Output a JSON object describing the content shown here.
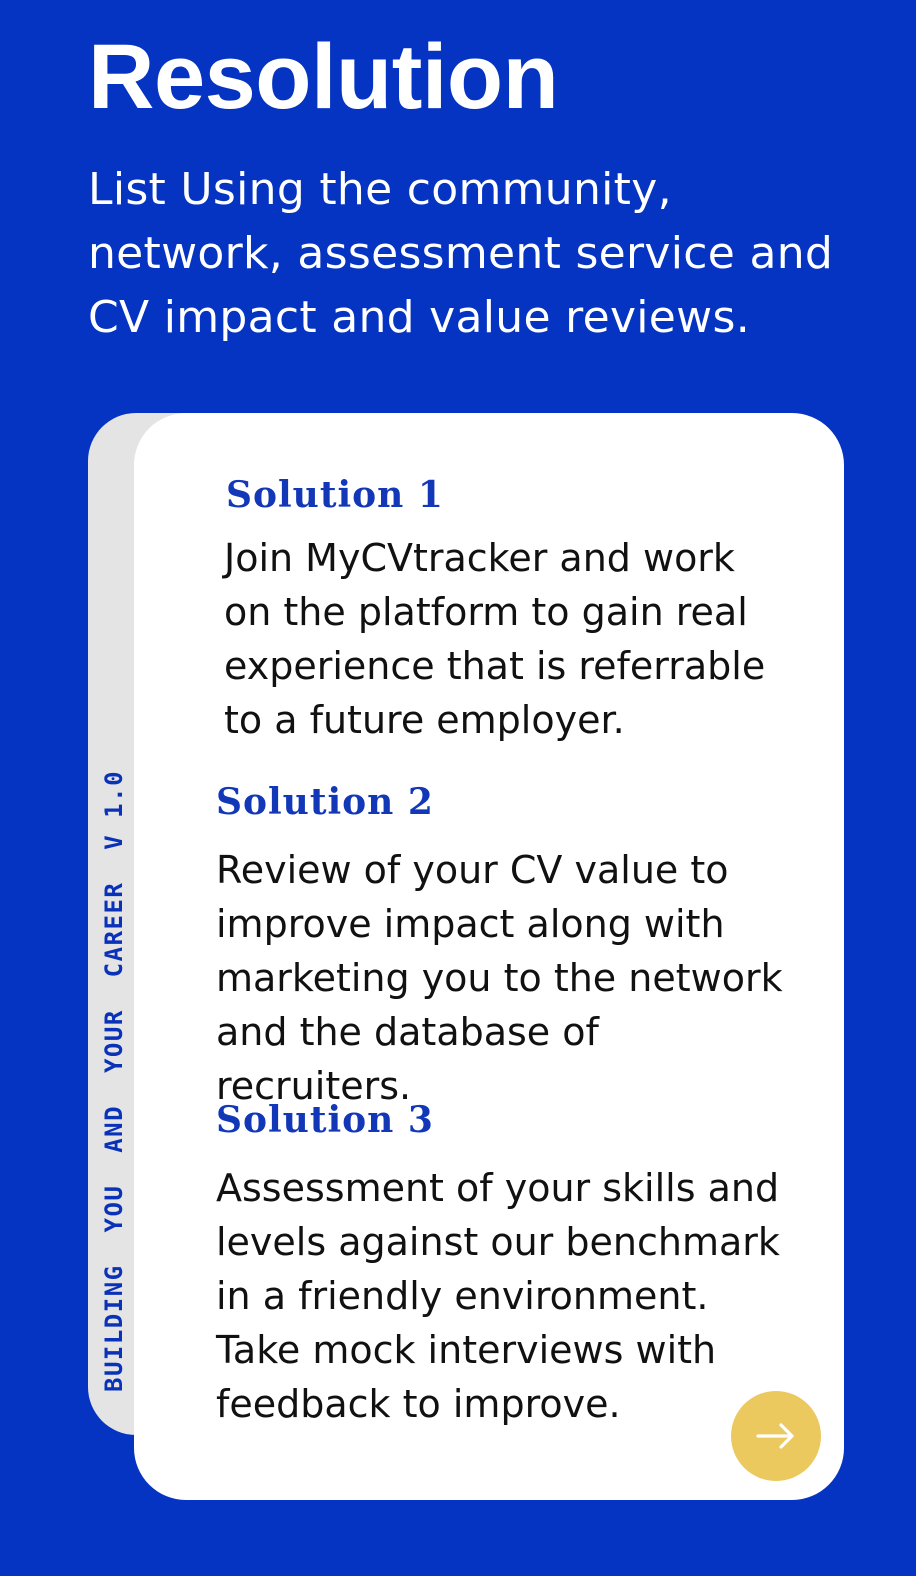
{
  "header": {
    "title": "Resolution",
    "subtitle": "List Using the community, network, assessment service and CV impact and value reviews."
  },
  "side_label": "BUILDING  YOU  AND  YOUR  CAREER  V 1.0",
  "solutions": [
    {
      "title": "Solution 1",
      "body": "Join MyCVtracker and work on the platform to gain real experience that is referrable to a future employer."
    },
    {
      "title": "Solution 2",
      "body": "Review of your CV value to improve impact along with marketing you to the network and the database of recruiters."
    },
    {
      "title": "Solution 3",
      "body": "Assessment of your skills and levels against our benchmark in a friendly environment. Take mock interviews with feedback to improve."
    }
  ],
  "next_button": {
    "icon": "arrow-right-icon"
  },
  "colors": {
    "background": "#0533c2",
    "card": "#ffffff",
    "card_back": "#e4e4e4",
    "accent_text": "#1238b8",
    "button": "#ebc95e"
  }
}
